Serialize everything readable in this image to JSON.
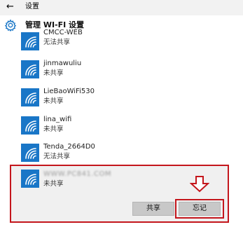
{
  "window": {
    "back_glyph": "←",
    "title": "设置"
  },
  "header": {
    "icon": "gear-icon",
    "title": "管理 WI-FI 设置"
  },
  "networks": [
    {
      "name": "CMCC-WEB",
      "status": "无法共享"
    },
    {
      "name": "jinmawuliu",
      "status": "未共享"
    },
    {
      "name": "LieBaoWiFi530",
      "status": "未共享"
    },
    {
      "name": "lina_wifi",
      "status": "未共享"
    },
    {
      "name": "Tenda_2664D0",
      "status": "无法共享"
    },
    {
      "name": "WWW.PC841.COM",
      "status": "未共享"
    }
  ],
  "selected_actions": {
    "share_label": "共享",
    "forget_label": "忘记"
  },
  "colors": {
    "accent": "#1976c7",
    "highlight": "#c4161c"
  }
}
